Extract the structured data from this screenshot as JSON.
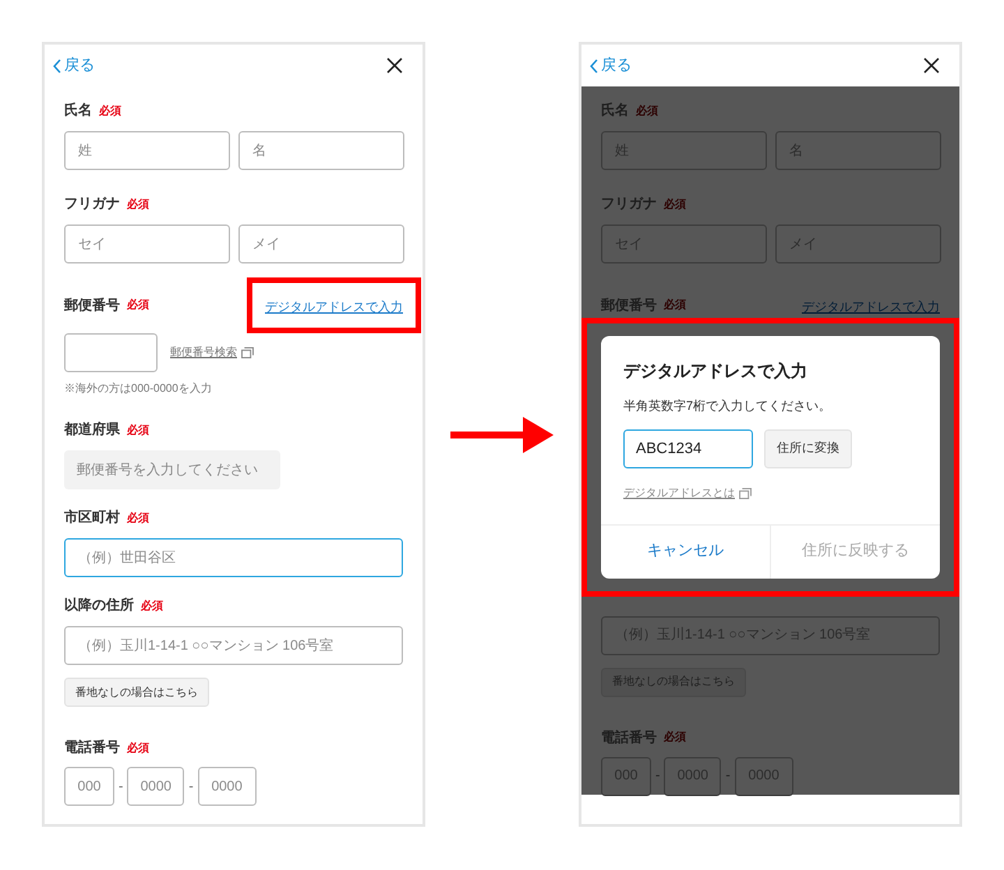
{
  "screens": [
    {
      "back": "戻る",
      "dimmed": false,
      "sections": [
        {
          "kind": "pair",
          "label": "氏名",
          "required": "必須",
          "placeholders": [
            "姓",
            "名"
          ]
        },
        {
          "kind": "pair",
          "label": "フリガナ",
          "required": "必須",
          "placeholders": [
            "セイ",
            "メイ"
          ]
        },
        {
          "kind": "postal",
          "label": "郵便番号",
          "required": "必須",
          "link": "デジタルアドレスで入力",
          "link_highlighted": true,
          "search_link": "郵便番号検索",
          "note": "※海外の方は000-0000を入力"
        },
        {
          "kind": "select",
          "label": "都道府県",
          "required": "必須",
          "placeholder": "郵便番号を入力してください"
        },
        {
          "kind": "text",
          "label": "市区町村",
          "required": "必須",
          "placeholder": "（例）世田谷区",
          "focused": true
        },
        {
          "kind": "text",
          "label": "以降の住所",
          "required": "必須",
          "placeholder": "（例）玉川1-14-1 ○○マンション 106号室",
          "focused": false,
          "button": "番地なしの場合はこちら"
        },
        {
          "kind": "phone",
          "label": "電話番号",
          "required": "必須",
          "placeholders": [
            "000",
            "0000",
            "0000"
          ],
          "separators": [
            "-",
            "-"
          ]
        }
      ]
    },
    {
      "back": "戻る",
      "dimmed": true,
      "sections": [
        {
          "kind": "pair",
          "label": "氏名",
          "required": "必須",
          "placeholders": [
            "姓",
            "名"
          ]
        },
        {
          "kind": "pair",
          "label": "フリガナ",
          "required": "必須",
          "placeholders": [
            "セイ",
            "メイ"
          ]
        },
        {
          "kind": "postal",
          "label": "郵便番号",
          "required": "必須",
          "link": "デジタルアドレスで入力",
          "link_highlighted": false
        },
        {
          "kind": "dialog",
          "highlighted": true,
          "title": "デジタルアドレスで入力",
          "message": "半角英数字7桁で入力してください。",
          "value": "ABC1234",
          "convert_button": "住所に変換",
          "help_link": "デジタルアドレスとは",
          "cancel": "キャンセル",
          "apply": "住所に反映する",
          "apply_disabled": true
        },
        {
          "kind": "text",
          "placeholder": "（例）玉川1-14-1 ○○マンション 106号室",
          "focused": false,
          "button": "番地なしの場合はこちら"
        },
        {
          "kind": "phone",
          "label": "電話番号",
          "required": "必須",
          "placeholders": [
            "000",
            "0000",
            "0000"
          ],
          "separators": [
            "-",
            "-"
          ]
        }
      ]
    }
  ]
}
